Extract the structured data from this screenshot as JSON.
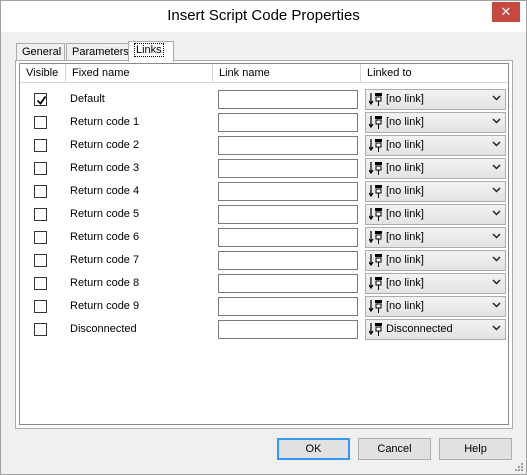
{
  "window": {
    "title": "Insert Script Code Properties"
  },
  "tabs": [
    {
      "label": "General"
    },
    {
      "label": "Parameters"
    },
    {
      "label": "Links"
    }
  ],
  "table": {
    "headers": [
      "Visible",
      "Fixed name",
      "Link name",
      "Linked to"
    ],
    "rows": [
      {
        "visible": true,
        "fixed_name": "Default",
        "link_name": "",
        "linked_to": "[no link]"
      },
      {
        "visible": false,
        "fixed_name": "Return code 1",
        "link_name": "",
        "linked_to": "[no link]"
      },
      {
        "visible": false,
        "fixed_name": "Return code 2",
        "link_name": "",
        "linked_to": "[no link]"
      },
      {
        "visible": false,
        "fixed_name": "Return code 3",
        "link_name": "",
        "linked_to": "[no link]"
      },
      {
        "visible": false,
        "fixed_name": "Return code 4",
        "link_name": "",
        "linked_to": "[no link]"
      },
      {
        "visible": false,
        "fixed_name": "Return code 5",
        "link_name": "",
        "linked_to": "[no link]"
      },
      {
        "visible": false,
        "fixed_name": "Return code 6",
        "link_name": "",
        "linked_to": "[no link]"
      },
      {
        "visible": false,
        "fixed_name": "Return code 7",
        "link_name": "",
        "linked_to": "[no link]"
      },
      {
        "visible": false,
        "fixed_name": "Return code 8",
        "link_name": "",
        "linked_to": "[no link]"
      },
      {
        "visible": false,
        "fixed_name": "Return code 9",
        "link_name": "",
        "linked_to": "[no link]"
      },
      {
        "visible": false,
        "fixed_name": "Disconnected",
        "link_name": "",
        "linked_to": "Disconnected"
      }
    ]
  },
  "buttons": {
    "ok": "OK",
    "cancel": "Cancel",
    "help": "Help"
  },
  "colors": {
    "close": "#c7483e",
    "focus": "#3399ff",
    "window_bg": "#f0f0f0"
  }
}
